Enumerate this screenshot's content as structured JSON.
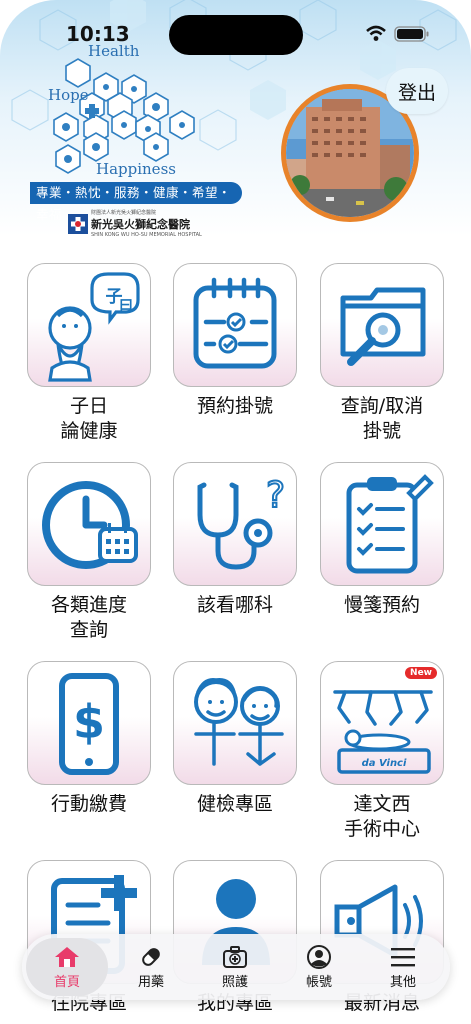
{
  "status_bar": {
    "time": "10:13"
  },
  "header": {
    "logo_words": {
      "health": "Health",
      "hope": "Hope",
      "happiness": "Happiness"
    },
    "slogan": "專業・熱忱・服務・健康・希望・幸福",
    "hospital_small": "財團法人新光吳火獅紀念醫院",
    "hospital_name": "新光吳火獅紀念醫院",
    "hospital_en": "SHIN KONG WU HO-SU MEMORIAL HOSPITAL",
    "logout_label": "登出"
  },
  "tiles": [
    {
      "label": "子日\n論健康",
      "icon": "confucius-icon"
    },
    {
      "label": "預約掛號",
      "icon": "calendar-check-icon"
    },
    {
      "label": "查詢/取消\n掛號",
      "icon": "folder-search-icon"
    },
    {
      "label": "各類進度\n查詢",
      "icon": "clock-calendar-icon"
    },
    {
      "label": "該看哪科",
      "icon": "stethoscope-icon"
    },
    {
      "label": "慢箋預約",
      "icon": "clipboard-checklist-icon"
    },
    {
      "label": "行動繳費",
      "icon": "phone-dollar-icon"
    },
    {
      "label": "健檢專區",
      "icon": "kids-icon"
    },
    {
      "label": "達文西\n手術中心",
      "icon": "robot-surgery-icon",
      "badge": "New",
      "sublabel": "da Vinci"
    },
    {
      "label": "住院專區",
      "icon": "document-plus-icon"
    },
    {
      "label": "我的專區",
      "icon": "person-icon"
    },
    {
      "label": "最新消息",
      "icon": "megaphone-icon"
    }
  ],
  "bottom_nav": [
    {
      "label": "首頁",
      "icon": "home-icon",
      "active": true
    },
    {
      "label": "用藥",
      "icon": "pill-icon"
    },
    {
      "label": "照護",
      "icon": "medkit-icon"
    },
    {
      "label": "帳號",
      "icon": "account-icon"
    },
    {
      "label": "其他",
      "icon": "menu-icon"
    }
  ],
  "colors": {
    "accent_blue": "#1c75bc",
    "slogan_blue": "#1665b2",
    "active_pink": "#e83b6a",
    "ring_orange": "#e8832a"
  }
}
